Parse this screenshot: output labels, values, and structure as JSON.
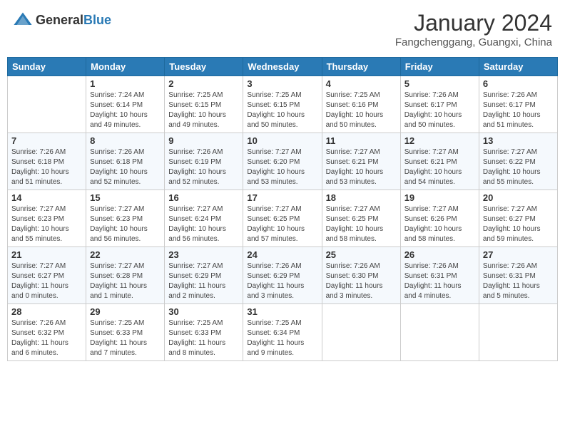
{
  "header": {
    "logo_general": "General",
    "logo_blue": "Blue",
    "month_title": "January 2024",
    "subtitle": "Fangchenggang, Guangxi, China"
  },
  "days_of_week": [
    "Sunday",
    "Monday",
    "Tuesday",
    "Wednesday",
    "Thursday",
    "Friday",
    "Saturday"
  ],
  "weeks": [
    [
      {
        "day": "",
        "info": ""
      },
      {
        "day": "1",
        "info": "Sunrise: 7:24 AM\nSunset: 6:14 PM\nDaylight: 10 hours\nand 49 minutes."
      },
      {
        "day": "2",
        "info": "Sunrise: 7:25 AM\nSunset: 6:15 PM\nDaylight: 10 hours\nand 49 minutes."
      },
      {
        "day": "3",
        "info": "Sunrise: 7:25 AM\nSunset: 6:15 PM\nDaylight: 10 hours\nand 50 minutes."
      },
      {
        "day": "4",
        "info": "Sunrise: 7:25 AM\nSunset: 6:16 PM\nDaylight: 10 hours\nand 50 minutes."
      },
      {
        "day": "5",
        "info": "Sunrise: 7:26 AM\nSunset: 6:17 PM\nDaylight: 10 hours\nand 50 minutes."
      },
      {
        "day": "6",
        "info": "Sunrise: 7:26 AM\nSunset: 6:17 PM\nDaylight: 10 hours\nand 51 minutes."
      }
    ],
    [
      {
        "day": "7",
        "info": "Sunrise: 7:26 AM\nSunset: 6:18 PM\nDaylight: 10 hours\nand 51 minutes."
      },
      {
        "day": "8",
        "info": "Sunrise: 7:26 AM\nSunset: 6:18 PM\nDaylight: 10 hours\nand 52 minutes."
      },
      {
        "day": "9",
        "info": "Sunrise: 7:26 AM\nSunset: 6:19 PM\nDaylight: 10 hours\nand 52 minutes."
      },
      {
        "day": "10",
        "info": "Sunrise: 7:27 AM\nSunset: 6:20 PM\nDaylight: 10 hours\nand 53 minutes."
      },
      {
        "day": "11",
        "info": "Sunrise: 7:27 AM\nSunset: 6:21 PM\nDaylight: 10 hours\nand 53 minutes."
      },
      {
        "day": "12",
        "info": "Sunrise: 7:27 AM\nSunset: 6:21 PM\nDaylight: 10 hours\nand 54 minutes."
      },
      {
        "day": "13",
        "info": "Sunrise: 7:27 AM\nSunset: 6:22 PM\nDaylight: 10 hours\nand 55 minutes."
      }
    ],
    [
      {
        "day": "14",
        "info": "Sunrise: 7:27 AM\nSunset: 6:23 PM\nDaylight: 10 hours\nand 55 minutes."
      },
      {
        "day": "15",
        "info": "Sunrise: 7:27 AM\nSunset: 6:23 PM\nDaylight: 10 hours\nand 56 minutes."
      },
      {
        "day": "16",
        "info": "Sunrise: 7:27 AM\nSunset: 6:24 PM\nDaylight: 10 hours\nand 56 minutes."
      },
      {
        "day": "17",
        "info": "Sunrise: 7:27 AM\nSunset: 6:25 PM\nDaylight: 10 hours\nand 57 minutes."
      },
      {
        "day": "18",
        "info": "Sunrise: 7:27 AM\nSunset: 6:25 PM\nDaylight: 10 hours\nand 58 minutes."
      },
      {
        "day": "19",
        "info": "Sunrise: 7:27 AM\nSunset: 6:26 PM\nDaylight: 10 hours\nand 58 minutes."
      },
      {
        "day": "20",
        "info": "Sunrise: 7:27 AM\nSunset: 6:27 PM\nDaylight: 10 hours\nand 59 minutes."
      }
    ],
    [
      {
        "day": "21",
        "info": "Sunrise: 7:27 AM\nSunset: 6:27 PM\nDaylight: 11 hours\nand 0 minutes."
      },
      {
        "day": "22",
        "info": "Sunrise: 7:27 AM\nSunset: 6:28 PM\nDaylight: 11 hours\nand 1 minute."
      },
      {
        "day": "23",
        "info": "Sunrise: 7:27 AM\nSunset: 6:29 PM\nDaylight: 11 hours\nand 2 minutes."
      },
      {
        "day": "24",
        "info": "Sunrise: 7:26 AM\nSunset: 6:29 PM\nDaylight: 11 hours\nand 3 minutes."
      },
      {
        "day": "25",
        "info": "Sunrise: 7:26 AM\nSunset: 6:30 PM\nDaylight: 11 hours\nand 3 minutes."
      },
      {
        "day": "26",
        "info": "Sunrise: 7:26 AM\nSunset: 6:31 PM\nDaylight: 11 hours\nand 4 minutes."
      },
      {
        "day": "27",
        "info": "Sunrise: 7:26 AM\nSunset: 6:31 PM\nDaylight: 11 hours\nand 5 minutes."
      }
    ],
    [
      {
        "day": "28",
        "info": "Sunrise: 7:26 AM\nSunset: 6:32 PM\nDaylight: 11 hours\nand 6 minutes."
      },
      {
        "day": "29",
        "info": "Sunrise: 7:25 AM\nSunset: 6:33 PM\nDaylight: 11 hours\nand 7 minutes."
      },
      {
        "day": "30",
        "info": "Sunrise: 7:25 AM\nSunset: 6:33 PM\nDaylight: 11 hours\nand 8 minutes."
      },
      {
        "day": "31",
        "info": "Sunrise: 7:25 AM\nSunset: 6:34 PM\nDaylight: 11 hours\nand 9 minutes."
      },
      {
        "day": "",
        "info": ""
      },
      {
        "day": "",
        "info": ""
      },
      {
        "day": "",
        "info": ""
      }
    ]
  ]
}
